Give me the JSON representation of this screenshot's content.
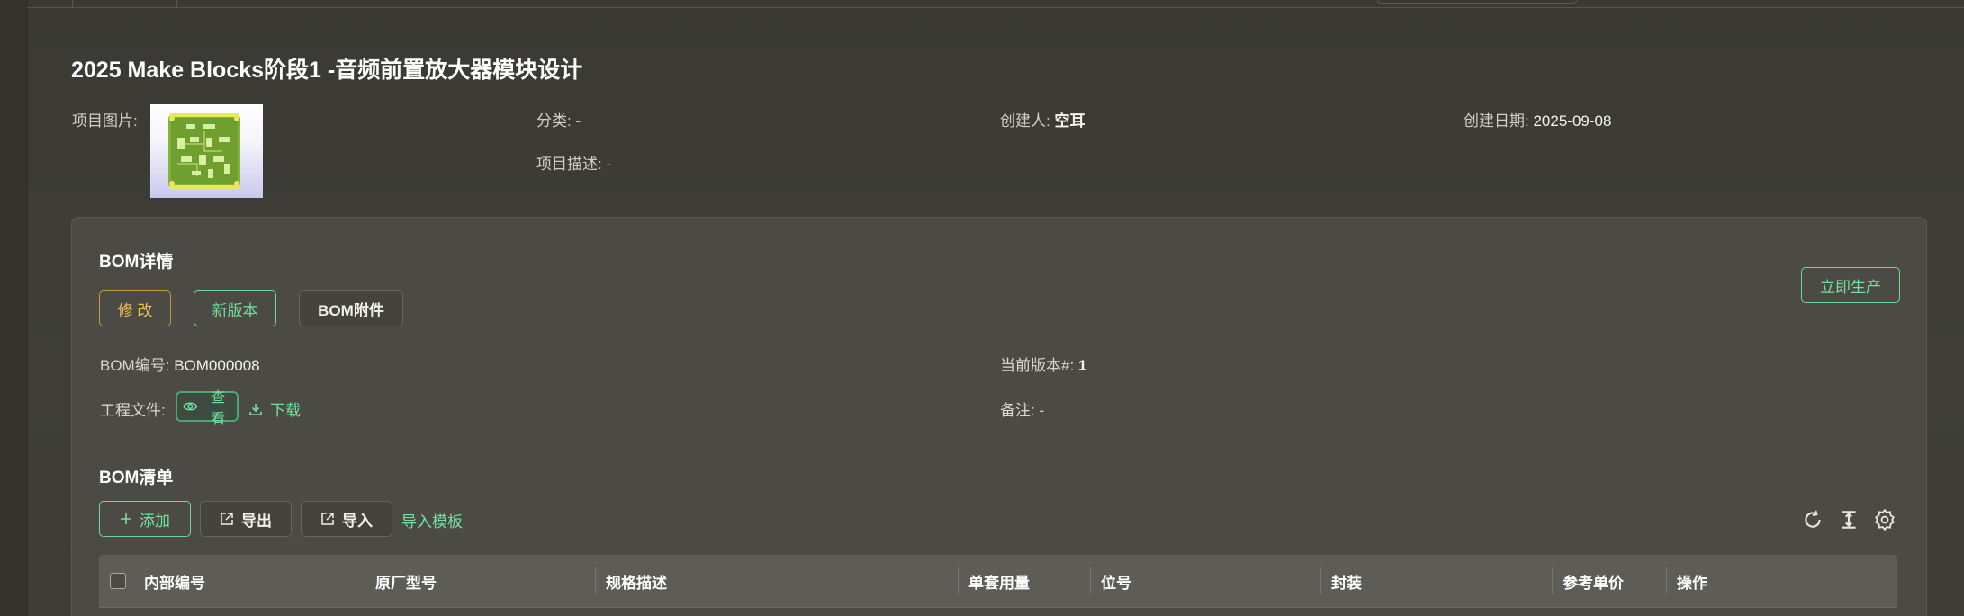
{
  "project": {
    "title": "2025 Make Blocks阶段1 -音频前置放大器模块设计",
    "image_label": "项目图片:",
    "category_label": "分类:",
    "category_value": "-",
    "creator_label": "创建人:",
    "creator_value": "空耳",
    "created_date_label": "创建日期:",
    "created_date_value": "2025-09-08",
    "description_label": "项目描述:",
    "description_value": "-"
  },
  "bom": {
    "title": "BOM详情",
    "edit_label": "修 改",
    "new_version_label": "新版本",
    "attachment_label": "BOM附件",
    "produce_label": "立即生产",
    "number_label": "BOM编号:",
    "number_value": "BOM000008",
    "version_label": "当前版本#:",
    "version_value": "1",
    "project_file_label": "工程文件:",
    "view_label": "查看",
    "download_label": "下载",
    "remark_label": "备注:",
    "remark_value": "-"
  },
  "bom_list": {
    "title": "BOM清单",
    "add_label": "添加",
    "export_label": "导出",
    "import_label": "导入",
    "import_template_label": "导入模板",
    "columns": [
      "内部编号",
      "原厂型号",
      "规格描述",
      "单套用量",
      "位号",
      "封装",
      "参考单价",
      "操作"
    ]
  },
  "colors": {
    "accent_green": "#74e0a0",
    "warn_yellow": "#f2c250",
    "background": "#3d3c37",
    "card": "#4b4a44"
  },
  "icons": [
    "eye-icon",
    "download-icon",
    "plus-icon",
    "export-icon",
    "import-icon",
    "refresh-icon",
    "column-height-icon",
    "settings-icon"
  ]
}
